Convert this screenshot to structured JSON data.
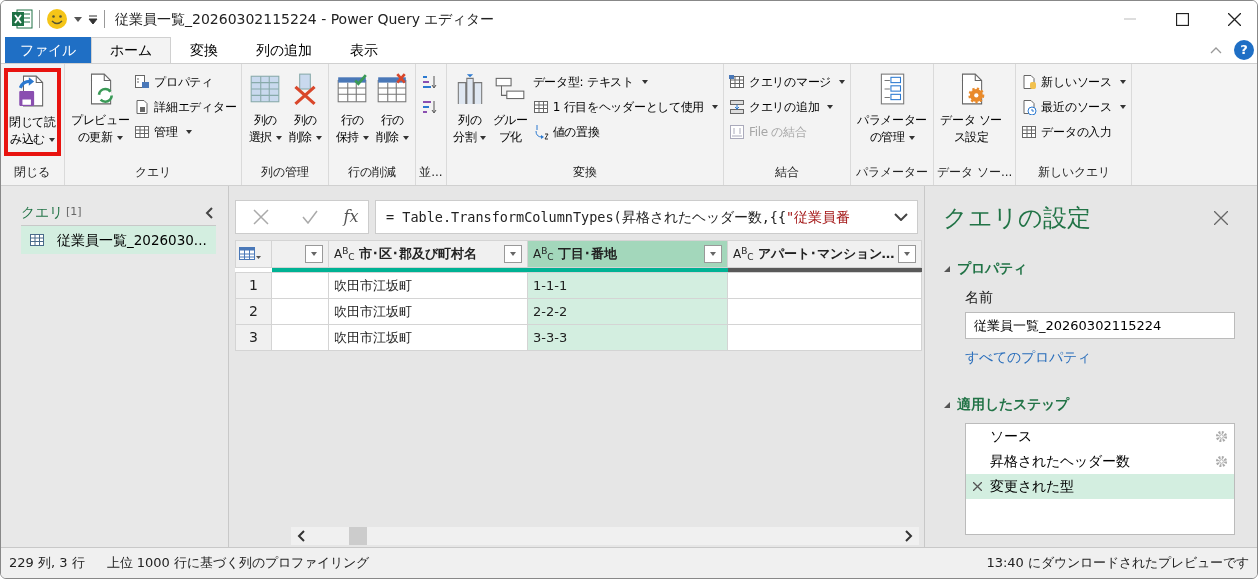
{
  "window": {
    "title": "従業員一覧_20260302115224 - Power Query エディター",
    "help": "?"
  },
  "tabs": [
    {
      "label": "ファイル",
      "kind": "file",
      "selected": false
    },
    {
      "label": "ホーム",
      "kind": "tab",
      "selected": true
    },
    {
      "label": "変換",
      "kind": "tab",
      "selected": false
    },
    {
      "label": "列の追加",
      "kind": "tab",
      "selected": false
    },
    {
      "label": "表示",
      "kind": "tab",
      "selected": false
    }
  ],
  "ribbon": {
    "groups": [
      {
        "label": "閉じる",
        "items": [
          {
            "kind": "large",
            "lines": [
              "閉じて読",
              "み込む"
            ],
            "dropdown": true,
            "highlighted": true
          }
        ]
      },
      {
        "label": "クエリ",
        "items": [
          {
            "kind": "large",
            "lines": [
              "プレビュー",
              "の更新"
            ],
            "dropdown": true
          },
          {
            "kind": "small",
            "label": "プロパティ",
            "dropdown": false
          },
          {
            "kind": "small",
            "label": "詳細エディター",
            "dropdown": false
          },
          {
            "kind": "small",
            "label": "管理",
            "dropdown": true
          }
        ]
      },
      {
        "label": "列の管理",
        "items": [
          {
            "kind": "large",
            "lines": [
              "列の",
              "選択"
            ],
            "dropdown": true
          },
          {
            "kind": "large",
            "lines": [
              "列の",
              "削除"
            ],
            "dropdown": true
          }
        ]
      },
      {
        "label": "行の削減",
        "items": [
          {
            "kind": "large",
            "lines": [
              "行の",
              "保持"
            ],
            "dropdown": true
          },
          {
            "kind": "large",
            "lines": [
              "行の",
              "削除"
            ],
            "dropdown": true
          }
        ]
      },
      {
        "label": "並...",
        "items": [
          {
            "kind": "icon"
          },
          {
            "kind": "icon"
          }
        ]
      },
      {
        "label": "変換",
        "items": [
          {
            "kind": "large",
            "lines": [
              "列の",
              "分割"
            ],
            "dropdown": true
          },
          {
            "kind": "large",
            "lines": [
              "グルー",
              "プ化"
            ],
            "dropdown": false
          },
          {
            "kind": "small",
            "label": "データ型: テキスト",
            "dropdown": true
          },
          {
            "kind": "small",
            "label": "1 行目をヘッダーとして使用",
            "dropdown": true
          },
          {
            "kind": "small",
            "label": "値の置換",
            "dropdown": false
          }
        ]
      },
      {
        "label": "結合",
        "items": [
          {
            "kind": "small",
            "label": "クエリのマージ",
            "dropdown": true
          },
          {
            "kind": "small",
            "label": "クエリの追加",
            "dropdown": true
          },
          {
            "kind": "small",
            "label": "File の結合",
            "dropdown": false,
            "disabled": true
          }
        ]
      },
      {
        "label": "パラメーター",
        "items": [
          {
            "kind": "large",
            "lines": [
              "パラメーター",
              "の管理"
            ],
            "dropdown": true
          }
        ]
      },
      {
        "label": "データ ソー...",
        "items": [
          {
            "kind": "large",
            "lines": [
              "データ ソー",
              "ス設定"
            ],
            "dropdown": false
          }
        ]
      },
      {
        "label": "新しいクエリ",
        "items": [
          {
            "kind": "small",
            "label": "新しいソース",
            "dropdown": true
          },
          {
            "kind": "small",
            "label": "最近のソース",
            "dropdown": true
          },
          {
            "kind": "small",
            "label": "データの入力",
            "dropdown": false
          }
        ]
      }
    ]
  },
  "queries": {
    "title": "クエリ",
    "count": "[1]",
    "items": [
      {
        "label": "従業員一覧_2026030...",
        "selected": true
      }
    ]
  },
  "formula": {
    "fx": "fx",
    "code": "= Table.TransformColumnTypes(昇格されたヘッダー数,{{",
    "string": "\"従業員番"
  },
  "table": {
    "columns": [
      {
        "filter": true,
        "selected": false,
        "color": "#00b294"
      },
      {
        "label": "市･区･郡及び町村名",
        "type_label": "A$^{B}$$_{C}$",
        "filter": true,
        "selected": false,
        "color": "#00b294"
      },
      {
        "label": "丁目･番地",
        "type_label": "A$^{B}$$_{C}$",
        "filter": true,
        "selected": true,
        "color": "#00b294"
      },
      {
        "label": "アパート･マンション…",
        "type_label": "A$^{B}$$_{C}$",
        "filter": true,
        "selected": false,
        "color": "#595959"
      }
    ],
    "rows": [
      {
        "number": "1",
        "cells": [
          null,
          "吹田市江坂町",
          "1-1-1",
          null
        ]
      },
      {
        "number": "2",
        "cells": [
          null,
          "吹田市江坂町",
          "2-2-2",
          null
        ]
      },
      {
        "number": "3",
        "cells": [
          null,
          "吹田市江坂町",
          "3-3-3",
          null
        ]
      }
    ]
  },
  "settings": {
    "title": "クエリの設定",
    "properties": {
      "title": "プロパティ",
      "expanded": true,
      "name_label": "名前",
      "name_value": "従業員一覧_20260302115224",
      "link": "すべてのプロパティ"
    },
    "steps": {
      "title": "適用したステップ",
      "expanded": true,
      "items": [
        {
          "label": "ソース",
          "has_settings": true,
          "selected": false
        },
        {
          "label": "昇格されたヘッダー数",
          "has_settings": true,
          "selected": false
        },
        {
          "label": "変更された型",
          "has_settings": false,
          "selected": true
        }
      ]
    }
  },
  "status_bar": {
    "left": [
      "229 列, 3 行",
      "上位 1000 行に基づく列のプロファイリング"
    ],
    "right": "13:40 にダウンロードされたプレビューです"
  }
}
